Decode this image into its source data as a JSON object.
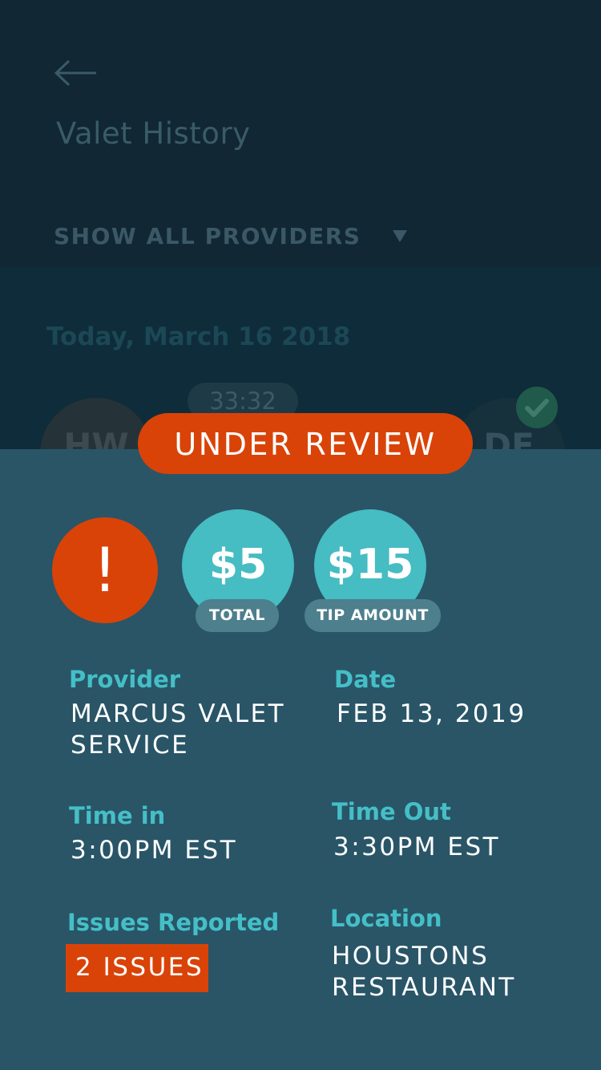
{
  "header": {
    "title": "Valet History",
    "filter_label": "SHOW ALL PROVIDERS"
  },
  "list": {
    "section_date": "Today, March 16 2018",
    "timer": "33:32",
    "left_avatar_initials": "HW",
    "right_avatar_initials": "DE"
  },
  "detail": {
    "status": "UNDER REVIEW",
    "alert_symbol": "!",
    "total_amount": "$5",
    "total_label": "TOTAL",
    "tip_amount": "$15",
    "tip_label": "TIP AMOUNT",
    "fields": {
      "provider_label": "Provider",
      "provider_value": "MARCUS VALET\nSERVICE",
      "date_label": "Date",
      "date_value": "FEB 13, 2019",
      "time_in_label": "Time in",
      "time_in_value": "3:00PM EST",
      "time_out_label": "Time Out",
      "time_out_value": "3:30PM EST",
      "issues_label": "Issues Reported",
      "issues_value": "2 ISSUES",
      "location_label": "Location",
      "location_value": "HOUSTONS\nRESTAURANT"
    }
  },
  "colors": {
    "accent_orange": "#d94308",
    "accent_teal": "#46bcc3",
    "sheet_background": "#295567"
  },
  "icons": {
    "back": "arrow-left-icon",
    "filter": "caret-down-icon",
    "check": "check-icon"
  }
}
